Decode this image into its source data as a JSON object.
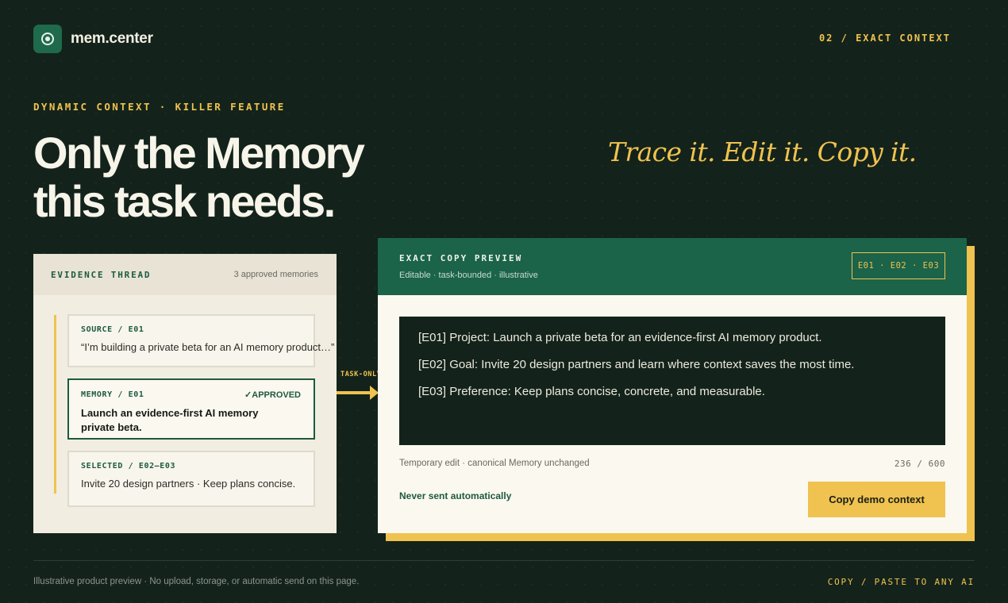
{
  "brand": {
    "name": "mem.center",
    "logo_icon": "target-dot-icon"
  },
  "header": {
    "step": "02 / EXACT CONTEXT"
  },
  "hero": {
    "eyebrow": "DYNAMIC CONTEXT · KILLER FEATURE",
    "headline": "Only the Memory this task needs.",
    "tagline": "Trace it. Edit it. Copy it."
  },
  "evidence": {
    "title": "EVIDENCE THREAD",
    "count": "3 approved memories",
    "cards": [
      {
        "label": "SOURCE / E01",
        "text": "“I’m building a private beta for an AI memory product…”"
      },
      {
        "label": "MEMORY / E01",
        "status": "✓APPROVED",
        "text": "Launch an evidence-first AI memory private beta."
      },
      {
        "label": "SELECTED / E02–E03",
        "text": "Invite 20 design partners · Keep plans concise."
      }
    ]
  },
  "connector": {
    "label": "TASK-ONLY"
  },
  "preview": {
    "title": "EXACT COPY PREVIEW",
    "subtitle": "Editable · task-bounded · illustrative",
    "refs": "E01 · E02 · E03",
    "lines": [
      "[E01] Project: Launch a private beta for an evidence-first AI memory product.",
      "[E02] Goal: Invite 20 design partners and learn where context saves the most time.",
      "[E03] Preference: Keep plans concise, concrete, and measurable."
    ],
    "edit_note": "Temporary edit · canonical Memory unchanged",
    "char_count": "236 / 600",
    "never_sent": "Never sent automatically",
    "copy_button": "Copy demo context"
  },
  "footer": {
    "note": "Illustrative product preview · No upload, storage, or automatic send on this page.",
    "cta": "COPY / PASTE TO ANY AI"
  },
  "colors": {
    "background": "#13231b",
    "accent_yellow": "#f0c24f",
    "brand_green": "#1b6349",
    "panel_cream": "#fbf8ef"
  }
}
